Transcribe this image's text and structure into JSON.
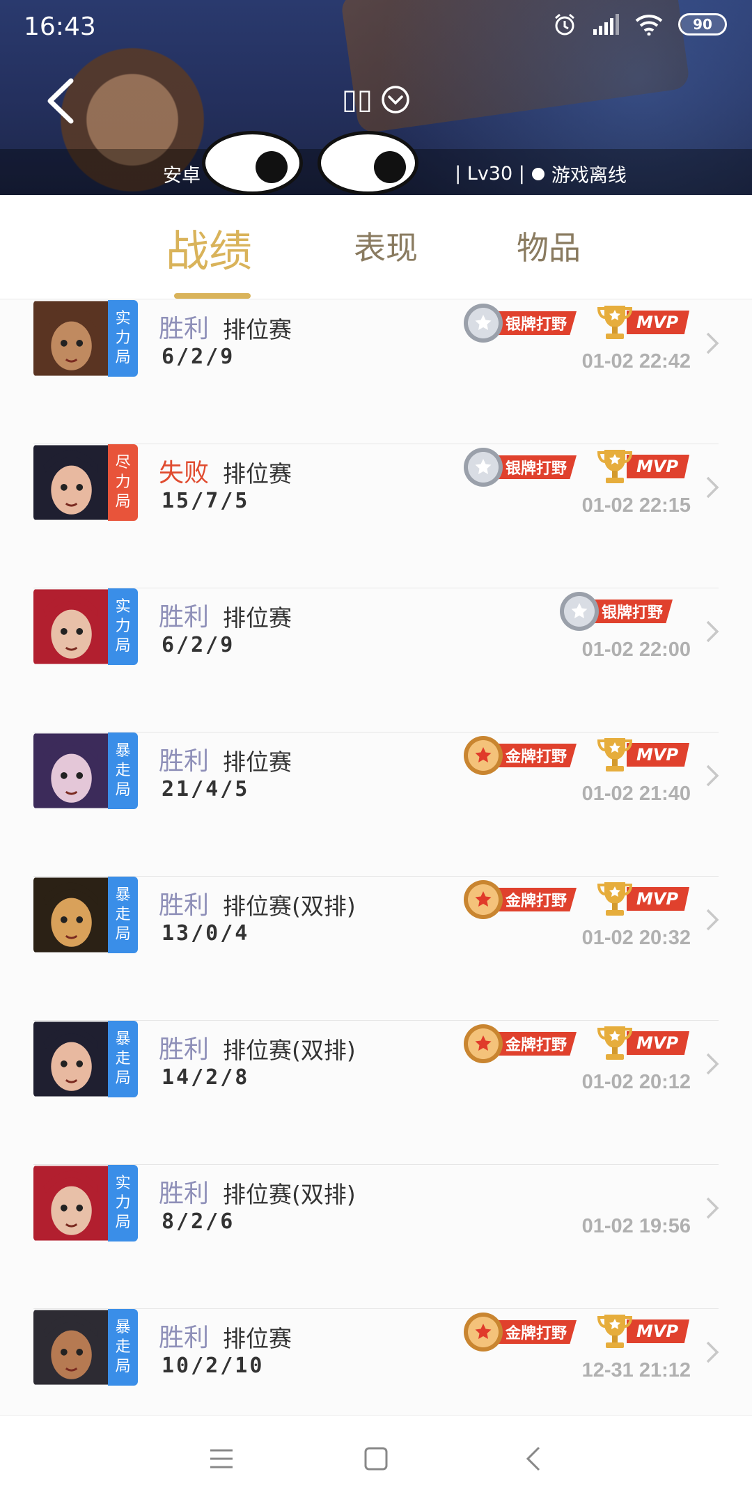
{
  "status_bar": {
    "time": "16:43",
    "battery": "90"
  },
  "header": {
    "title": "▯▯",
    "info_prefix": "安卓",
    "info_sep1": "|",
    "info_level": "| Lv30 |",
    "info_status": "游戏离线"
  },
  "tabs": [
    {
      "label": "战绩",
      "active": true
    },
    {
      "label": "表现",
      "active": false
    },
    {
      "label": "物品",
      "active": false
    }
  ],
  "matches": [
    {
      "result": "胜利",
      "result_type": "win",
      "mode_tag": [
        "实",
        "力",
        "局"
      ],
      "mode_color": "#3a8ee8",
      "match_type": "排位赛",
      "kda": "6/2/9",
      "time": "01-02 22:42",
      "badge": "银牌打野",
      "badge_kind": "silver",
      "mvp": "MVP",
      "portrait": "brown"
    },
    {
      "result": "失败",
      "result_type": "lose",
      "mode_tag": [
        "尽",
        "力",
        "局"
      ],
      "mode_color": "#e8543a",
      "match_type": "排位赛",
      "kda": "15/7/5",
      "time": "01-02 22:15",
      "badge": "银牌打野",
      "badge_kind": "silver",
      "mvp": "MVP",
      "portrait": "dark"
    },
    {
      "result": "胜利",
      "result_type": "win",
      "mode_tag": [
        "实",
        "力",
        "局"
      ],
      "mode_color": "#3a8ee8",
      "match_type": "排位赛",
      "kda": "6/2/9",
      "time": "01-02 22:00",
      "badge": "银牌打野",
      "badge_kind": "silver",
      "mvp": "",
      "portrait": "red"
    },
    {
      "result": "胜利",
      "result_type": "win",
      "mode_tag": [
        "暴",
        "走",
        "局"
      ],
      "mode_color": "#3a8ee8",
      "match_type": "排位赛",
      "kda": "21/4/5",
      "time": "01-02 21:40",
      "badge": "金牌打野",
      "badge_kind": "gold",
      "mvp": "MVP",
      "portrait": "purple"
    },
    {
      "result": "胜利",
      "result_type": "win",
      "mode_tag": [
        "暴",
        "走",
        "局"
      ],
      "mode_color": "#3a8ee8",
      "match_type": "排位赛(双排)",
      "kda": "13/0/4",
      "time": "01-02 20:32",
      "badge": "金牌打野",
      "badge_kind": "gold",
      "mvp": "MVP",
      "portrait": "gold"
    },
    {
      "result": "胜利",
      "result_type": "win",
      "mode_tag": [
        "暴",
        "走",
        "局"
      ],
      "mode_color": "#3a8ee8",
      "match_type": "排位赛(双排)",
      "kda": "14/2/8",
      "time": "01-02 20:12",
      "badge": "金牌打野",
      "badge_kind": "gold",
      "mvp": "MVP",
      "portrait": "dark"
    },
    {
      "result": "胜利",
      "result_type": "win",
      "mode_tag": [
        "实",
        "力",
        "局"
      ],
      "mode_color": "#3a8ee8",
      "match_type": "排位赛(双排)",
      "kda": "8/2/6",
      "time": "01-02 19:56",
      "badge": "",
      "badge_kind": "",
      "mvp": "",
      "portrait": "red"
    },
    {
      "result": "胜利",
      "result_type": "win",
      "mode_tag": [
        "暴",
        "走",
        "局"
      ],
      "mode_color": "#3a8ee8",
      "match_type": "排位赛",
      "kda": "10/2/10",
      "time": "12-31 21:12",
      "badge": "金牌打野",
      "badge_kind": "gold",
      "mvp": "MVP",
      "portrait": "tan"
    }
  ],
  "icons": {
    "back": "back-arrow-icon",
    "dropdown": "chevron-circle-icon",
    "alarm": "alarm-icon",
    "signal": "signal-icon",
    "wifi": "wifi-icon",
    "nav_menu": "menu-icon",
    "nav_home": "home-icon",
    "nav_back": "back-icon"
  }
}
